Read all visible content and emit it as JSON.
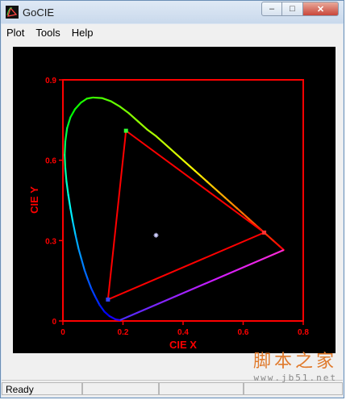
{
  "window": {
    "title": "GoCIE",
    "minimize_glyph": "–",
    "maximize_glyph": "□",
    "close_glyph": "✕"
  },
  "menu": [
    "Plot",
    "Tools",
    "Help"
  ],
  "status": {
    "text": "Ready"
  },
  "colors": {
    "axis": "#ff0000",
    "background": "#000000",
    "triangle": "#ff0000"
  },
  "chart_data": {
    "type": "scatter",
    "xlabel": "CIE X",
    "ylabel": "CIE Y",
    "xlim": [
      0,
      0.8
    ],
    "ylim": [
      0,
      0.9
    ],
    "xticks": [
      {
        "v": 0,
        "label": "0"
      },
      {
        "v": 0.2,
        "label": "0.2"
      },
      {
        "v": 0.4,
        "label": "0.4"
      },
      {
        "v": 0.6,
        "label": "0.6"
      },
      {
        "v": 0.8,
        "label": "0.8"
      }
    ],
    "yticks": [
      {
        "v": 0,
        "label": "0"
      },
      {
        "v": 0.3,
        "label": "0.3"
      },
      {
        "v": 0.6,
        "label": "0.6"
      },
      {
        "v": 0.9,
        "label": "0.9"
      }
    ],
    "spectral_locus": [
      [
        0.735,
        0.265
      ],
      [
        0.72,
        0.28
      ],
      [
        0.7,
        0.3
      ],
      [
        0.68,
        0.32
      ],
      [
        0.66,
        0.34
      ],
      [
        0.64,
        0.36
      ],
      [
        0.62,
        0.38
      ],
      [
        0.6,
        0.4
      ],
      [
        0.58,
        0.42
      ],
      [
        0.56,
        0.44
      ],
      [
        0.54,
        0.46
      ],
      [
        0.52,
        0.48
      ],
      [
        0.5,
        0.5
      ],
      [
        0.48,
        0.52
      ],
      [
        0.46,
        0.54
      ],
      [
        0.44,
        0.56
      ],
      [
        0.42,
        0.58
      ],
      [
        0.4,
        0.6
      ],
      [
        0.37,
        0.63
      ],
      [
        0.34,
        0.66
      ],
      [
        0.31,
        0.69
      ],
      [
        0.28,
        0.715
      ],
      [
        0.25,
        0.745
      ],
      [
        0.22,
        0.775
      ],
      [
        0.19,
        0.8
      ],
      [
        0.16,
        0.82
      ],
      [
        0.13,
        0.832
      ],
      [
        0.1,
        0.834
      ],
      [
        0.08,
        0.83
      ],
      [
        0.06,
        0.815
      ],
      [
        0.04,
        0.79
      ],
      [
        0.025,
        0.76
      ],
      [
        0.014,
        0.72
      ],
      [
        0.008,
        0.67
      ],
      [
        0.006,
        0.62
      ],
      [
        0.008,
        0.57
      ],
      [
        0.012,
        0.52
      ],
      [
        0.018,
        0.47
      ],
      [
        0.025,
        0.42
      ],
      [
        0.033,
        0.37
      ],
      [
        0.042,
        0.32
      ],
      [
        0.052,
        0.27
      ],
      [
        0.062,
        0.23
      ],
      [
        0.072,
        0.19
      ],
      [
        0.083,
        0.155
      ],
      [
        0.095,
        0.12
      ],
      [
        0.108,
        0.09
      ],
      [
        0.122,
        0.06
      ],
      [
        0.138,
        0.035
      ],
      [
        0.155,
        0.018
      ],
      [
        0.175,
        0.006
      ],
      [
        0.19,
        0.003
      ]
    ],
    "purple_line": [
      [
        0.19,
        0.003
      ],
      [
        0.735,
        0.265
      ]
    ],
    "gamut_triangle": [
      [
        0.21,
        0.71
      ],
      [
        0.67,
        0.33
      ],
      [
        0.15,
        0.08
      ]
    ],
    "primaries": [
      {
        "name": "green",
        "x": 0.21,
        "y": 0.71,
        "color": "#33ff33"
      },
      {
        "name": "red",
        "x": 0.67,
        "y": 0.33,
        "color": "#ff3333"
      },
      {
        "name": "blue",
        "x": 0.15,
        "y": 0.08,
        "color": "#3344ff"
      }
    ],
    "white_point": {
      "x": 0.31,
      "y": 0.32
    }
  },
  "watermark": {
    "text": "脚本之家",
    "url": "www.jb51.net"
  }
}
